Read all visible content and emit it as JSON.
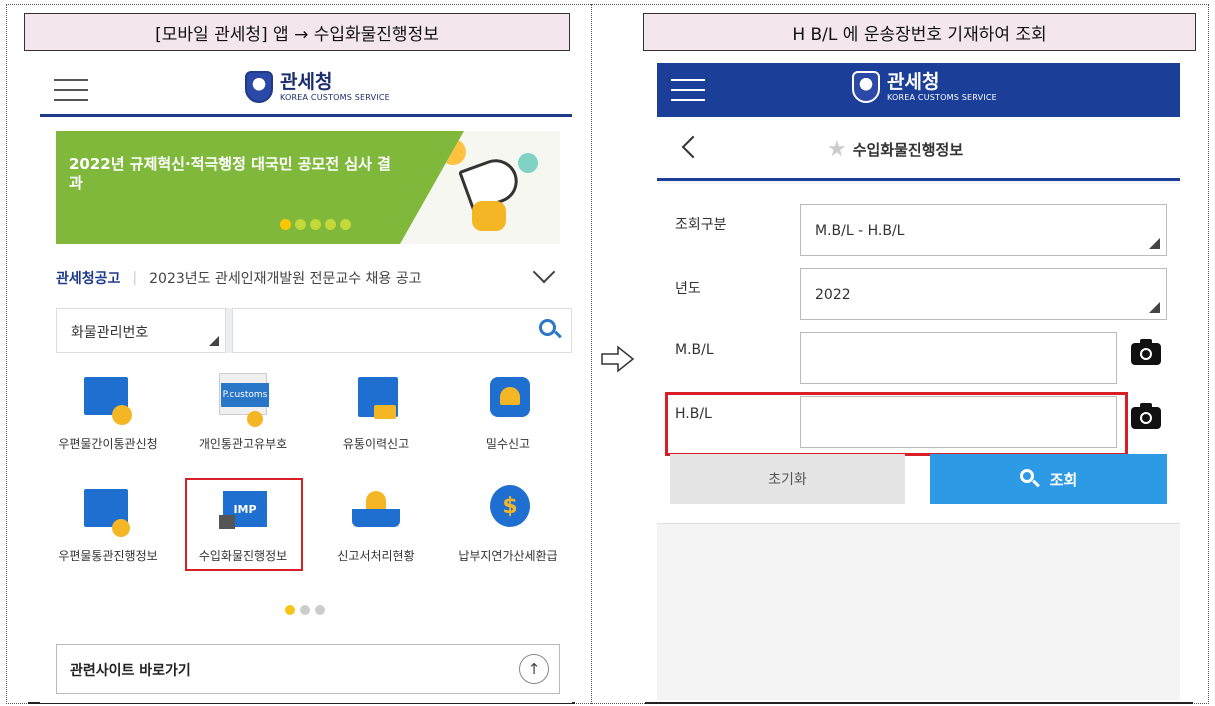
{
  "captions": {
    "left": "[모바일 관세청] 앱 → 수입화물진행정보",
    "right": "H B/L 에 운송장번호 기재하여 조회"
  },
  "logo": {
    "name_ko": "관세청",
    "name_en": "KOREA CUSTOMS SERVICE"
  },
  "left_app": {
    "banner": {
      "text": "2022년 규제혁신·적극행정 대국민 공모전 심사 결과",
      "active_page": 1,
      "page_count": 5
    },
    "notice": {
      "tag": "관세청공고",
      "message": "2023년도 관세인재개발원 전문교수 채용 공고"
    },
    "search": {
      "select_value": "화물관리번호",
      "input_value": ""
    },
    "menu": [
      {
        "label": "우편물간이통관신청",
        "icon": "mail-check-icon"
      },
      {
        "label": "개인통관고유부호",
        "icon": "personal-customs-code-icon",
        "icon_text": "P.customs"
      },
      {
        "label": "유통이력신고",
        "icon": "distribution-report-icon"
      },
      {
        "label": "밀수신고",
        "icon": "smuggling-report-icon"
      },
      {
        "label": "우편물통관진행정보",
        "icon": "mail-search-icon"
      },
      {
        "label": "수입화물진행정보",
        "icon": "import-cargo-icon",
        "icon_text": "IMP"
      },
      {
        "label": "신고서처리현황",
        "icon": "report-status-icon"
      },
      {
        "label": "납부지연가산세환급",
        "icon": "refund-dollar-icon",
        "icon_text": "$"
      }
    ],
    "menu_page": {
      "active": 1,
      "count": 3
    },
    "related_sites": "관련사이트 바로가기",
    "scroll_up_symbol": "↑"
  },
  "right_app": {
    "title": "수입화물진행정보",
    "fields": {
      "query_type_label": "조회구분",
      "query_type_value": "M.B/L - H.B/L",
      "year_label": "년도",
      "year_value": "2022",
      "mbl_label": "M.B/L",
      "mbl_value": "",
      "hbl_label": "H.B/L",
      "hbl_value": ""
    },
    "buttons": {
      "reset": "초기화",
      "search": "조회"
    }
  },
  "colors": {
    "brand_navy": "#1b3e99",
    "highlight_red": "#d81f26",
    "search_blue": "#2d9ae5",
    "banner_green": "#7fb83a",
    "caption_bg": "#f3e6ec"
  }
}
